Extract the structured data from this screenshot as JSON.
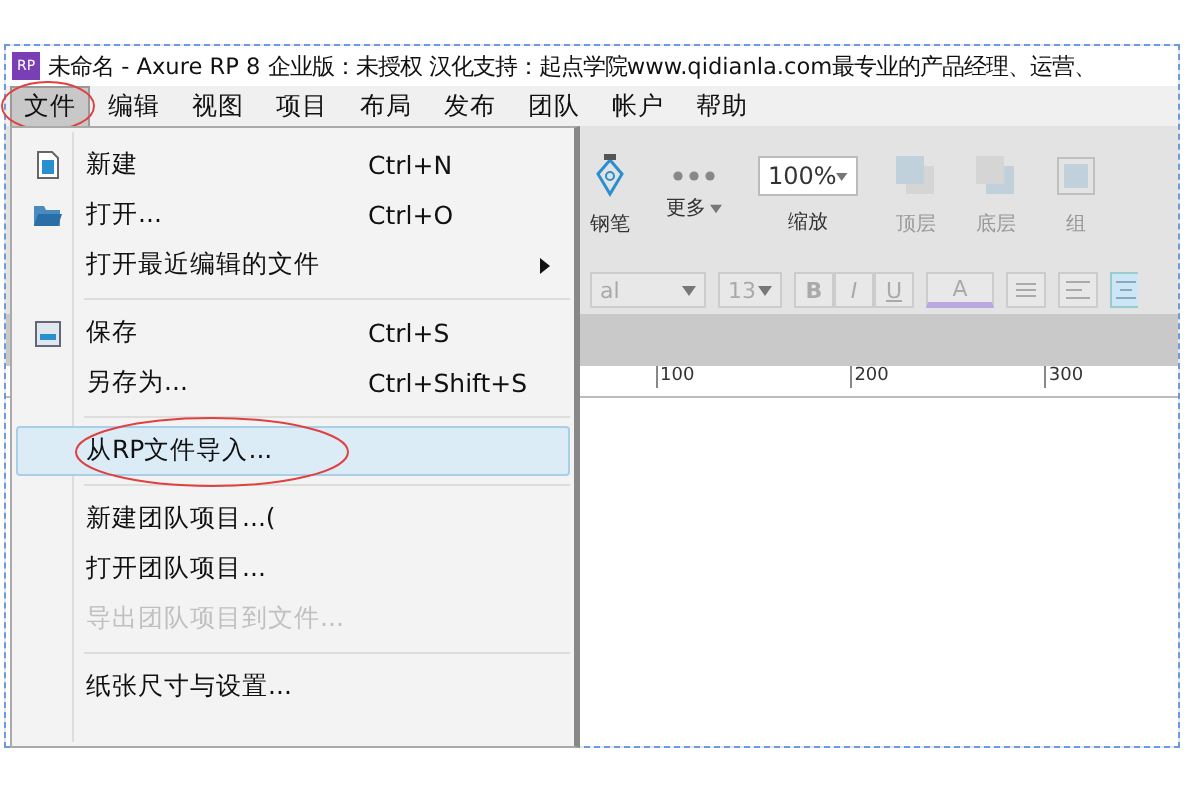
{
  "window": {
    "logo": "RP",
    "title": "未命名 - Axure RP 8 企业版：未授权 汉化支持：起点学院www.qidianla.com最专业的产品经理、运营、"
  },
  "menubar": [
    {
      "label": "文件",
      "selected": true,
      "circled": true
    },
    {
      "label": "编辑",
      "selected": false,
      "circled": false
    },
    {
      "label": "视图",
      "selected": false,
      "circled": false
    },
    {
      "label": "项目",
      "selected": false,
      "circled": false
    },
    {
      "label": "布局",
      "selected": false,
      "circled": false
    },
    {
      "label": "发布",
      "selected": false,
      "circled": false
    },
    {
      "label": "团队",
      "selected": false,
      "circled": false
    },
    {
      "label": "帐户",
      "selected": false,
      "circled": false
    },
    {
      "label": "帮助",
      "selected": false,
      "circled": false
    }
  ],
  "toolbar": {
    "items": [
      {
        "kind": "pen",
        "label": "钢笔",
        "disabled": false
      },
      {
        "kind": "more",
        "label": "更多",
        "disabled": false
      },
      {
        "kind": "zoom",
        "value": "100%",
        "label": "缩放"
      },
      {
        "kind": "top",
        "label": "顶层",
        "disabled": true
      },
      {
        "kind": "bottom",
        "label": "底层",
        "disabled": true
      },
      {
        "kind": "group",
        "label": "组",
        "disabled": true
      }
    ]
  },
  "format_bar": {
    "font": "al",
    "size": "13",
    "bold": "B",
    "italic": "I",
    "underline": "U",
    "text_color_label": "A"
  },
  "ruler": {
    "labels": [
      "100",
      "200",
      "300"
    ]
  },
  "file_menu": [
    {
      "kind": "new",
      "label": "新建",
      "shortcut": "Ctrl+N",
      "submenu": false,
      "disabled": false,
      "selected": false,
      "circled": false
    },
    {
      "kind": "open",
      "label": "打开...",
      "shortcut": "Ctrl+O",
      "submenu": false,
      "disabled": false,
      "selected": false,
      "circled": false
    },
    {
      "kind": "plain",
      "label": "打开最近编辑的文件",
      "submenu": true,
      "disabled": false,
      "selected": false,
      "circled": false
    },
    {
      "kind": "separator"
    },
    {
      "kind": "save",
      "label": "保存",
      "shortcut": "Ctrl+S",
      "submenu": false,
      "disabled": false,
      "selected": false,
      "circled": false
    },
    {
      "kind": "plain",
      "label": "另存为...",
      "shortcut": "Ctrl+Shift+S",
      "submenu": false,
      "disabled": false,
      "selected": false,
      "circled": false
    },
    {
      "kind": "separator"
    },
    {
      "kind": "plain",
      "label": "从RP文件导入...",
      "submenu": false,
      "disabled": false,
      "selected": true,
      "circled": true
    },
    {
      "kind": "separator"
    },
    {
      "kind": "plain",
      "label": "新建团队项目...(",
      "submenu": false,
      "disabled": false,
      "selected": false,
      "circled": false
    },
    {
      "kind": "plain",
      "label": "打开团队项目...",
      "submenu": false,
      "disabled": false,
      "selected": false,
      "circled": false
    },
    {
      "kind": "plain",
      "label": "导出团队项目到文件...",
      "submenu": false,
      "disabled": true,
      "selected": false,
      "circled": false
    },
    {
      "kind": "separator"
    },
    {
      "kind": "plain",
      "label": "纸张尺寸与设置...",
      "submenu": false,
      "disabled": false,
      "selected": false,
      "circled": false
    }
  ]
}
